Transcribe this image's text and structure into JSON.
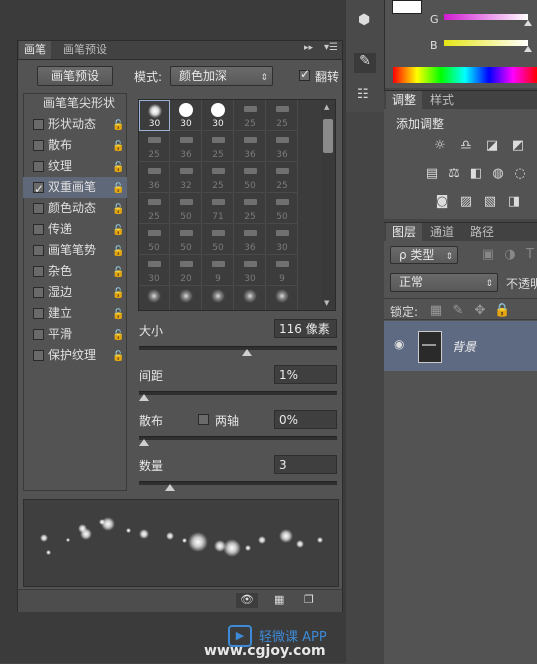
{
  "brush_panel": {
    "tabs": [
      "画笔",
      "画笔预设"
    ],
    "preset_button": "画笔预设",
    "mode_label": "模式:",
    "mode_value": "颜色加深",
    "flip_label": "翻转",
    "options": [
      {
        "label": "画笔笔尖形状",
        "checked": null,
        "locked": false,
        "selected": false
      },
      {
        "label": "形状动态",
        "checked": false,
        "locked": true,
        "selected": false
      },
      {
        "label": "散布",
        "checked": false,
        "locked": true,
        "selected": false
      },
      {
        "label": "纹理",
        "checked": false,
        "locked": true,
        "selected": false
      },
      {
        "label": "双重画笔",
        "checked": true,
        "locked": true,
        "selected": true
      },
      {
        "label": "颜色动态",
        "checked": false,
        "locked": true,
        "selected": false
      },
      {
        "label": "传递",
        "checked": false,
        "locked": true,
        "selected": false
      },
      {
        "label": "画笔笔势",
        "checked": false,
        "locked": true,
        "selected": false
      },
      {
        "label": "杂色",
        "checked": false,
        "locked": true,
        "selected": false
      },
      {
        "label": "湿边",
        "checked": false,
        "locked": true,
        "selected": false
      },
      {
        "label": "建立",
        "checked": false,
        "locked": true,
        "selected": false
      },
      {
        "label": "平滑",
        "checked": false,
        "locked": true,
        "selected": false
      },
      {
        "label": "保护纹理",
        "checked": false,
        "locked": true,
        "selected": false
      }
    ],
    "brush_grid": [
      [
        "30",
        "30",
        "30",
        "25",
        "25"
      ],
      [
        "25",
        "36",
        "25",
        "36",
        "36"
      ],
      [
        "36",
        "32",
        "25",
        "50",
        "25"
      ],
      [
        "25",
        "50",
        "71",
        "25",
        "50"
      ],
      [
        "50",
        "50",
        "50",
        "36",
        "30"
      ],
      [
        "30",
        "20",
        "9",
        "30",
        "9"
      ],
      [
        "",
        "",
        "",
        "",
        ""
      ]
    ],
    "size_label": "大小",
    "size_value": "116 像素",
    "size_level": 0.55,
    "spacing_label": "间距",
    "spacing_value": "1%",
    "spacing_level": 0.0,
    "scatter_label": "散布",
    "both_axes_label": "两轴",
    "scatter_value": "0%",
    "scatter_level": 0.0,
    "count_label": "数量",
    "count_value": "3",
    "count_level": 0.14
  },
  "color_panel": {
    "g_label": "G",
    "b_label": "B",
    "g_color": "#d21bd2",
    "b_color": "#e5e516"
  },
  "adjustments_panel": {
    "tabs": [
      "调整",
      "样式"
    ],
    "title": "添加调整"
  },
  "layers_panel": {
    "tabs": [
      "图层",
      "通道",
      "路径"
    ],
    "filter_label": "ρ 类型",
    "blend_mode": "正常",
    "opacity_label": "不透明",
    "lock_label": "锁定:",
    "layer_name": "背景"
  },
  "watermark": {
    "line1": "轻微课 APP",
    "line2": "www.cgjoy.com"
  }
}
